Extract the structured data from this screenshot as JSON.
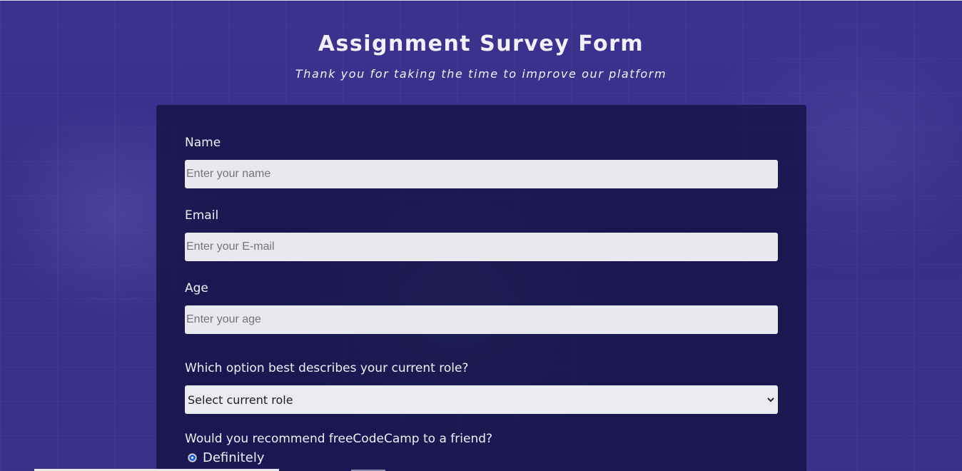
{
  "header": {
    "title": "Assignment Survey Form",
    "subtitle": "Thank you for taking the time to improve our platform"
  },
  "form": {
    "name": {
      "label": "Name",
      "placeholder": "Enter your name",
      "value": ""
    },
    "email": {
      "label": "Email",
      "placeholder": "Enter your E-mail",
      "value": ""
    },
    "age": {
      "label": "Age",
      "placeholder": "Enter your age",
      "value": ""
    },
    "role": {
      "label": "Which option best describes your current role?",
      "selected": "Select current role"
    },
    "recommend": {
      "label": "Would you recommend freeCodeCamp to a friend?",
      "options": [
        {
          "label": "Definitely",
          "checked": true
        }
      ]
    }
  },
  "colors": {
    "background": "#3a2f86",
    "card": "#14124a",
    "radio_accent": "#1a5fd6",
    "text": "#f0eef8"
  },
  "icons": {
    "select_arrow": "chevron-down-icon"
  }
}
